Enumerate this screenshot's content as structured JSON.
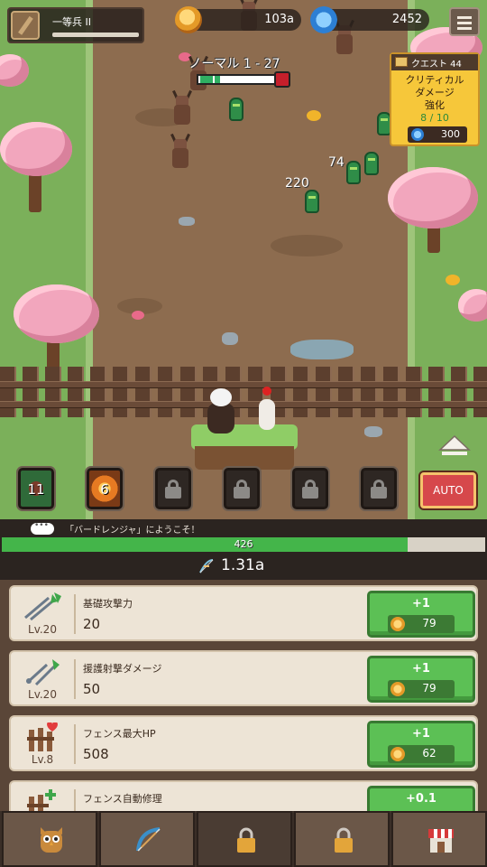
{
  "hud": {
    "player_rank": "一等兵 II",
    "coins": "103a",
    "gems": "2452",
    "stage_label": "ノーマル 1 - 27"
  },
  "quest": {
    "title": "クエスト 44",
    "line1": "クリティカル",
    "line2": "ダメージ",
    "line3": "強化",
    "progress": "8 / 10",
    "reward": "300"
  },
  "damage_numbers": [
    "220",
    "74"
  ],
  "skills": [
    {
      "type": "plant",
      "count": "11"
    },
    {
      "type": "fire",
      "count": "6"
    },
    {
      "type": "locked"
    },
    {
      "type": "locked"
    },
    {
      "type": "locked"
    },
    {
      "type": "locked"
    }
  ],
  "auto_label": "AUTO",
  "message": "「バードレンジャ」にようこそ！",
  "fence_hp": {
    "value": "426",
    "fill_fraction": 0.84
  },
  "attack_power": "1.31a",
  "upgrades": [
    {
      "name": "基礎攻撃力",
      "level": "Lv.20",
      "value": "20",
      "increment": "+1",
      "cost": "79",
      "icon": "arrows-icon"
    },
    {
      "name": "援護射撃ダメージ",
      "level": "Lv.20",
      "value": "50",
      "increment": "+1",
      "cost": "79",
      "icon": "support-arrows-icon"
    },
    {
      "name": "フェンス最大HP",
      "level": "Lv.8",
      "value": "508",
      "increment": "+1",
      "cost": "62",
      "icon": "fence-heart-icon"
    },
    {
      "name": "フェンス自動修理",
      "level": "",
      "value": "",
      "increment": "+0.1",
      "cost": "",
      "icon": "fence-repair-icon"
    }
  ],
  "tabs": [
    {
      "name": "owl",
      "icon": "owl-icon"
    },
    {
      "name": "bow",
      "icon": "bow-icon"
    },
    {
      "name": "locked-1",
      "icon": "lock-icon"
    },
    {
      "name": "locked-2",
      "icon": "lock-icon"
    },
    {
      "name": "shop",
      "icon": "shop-icon"
    }
  ],
  "colors": {
    "hp_green": "#44b54a",
    "upgrade_button": "#5cc055",
    "auto_red": "#d6484b"
  }
}
